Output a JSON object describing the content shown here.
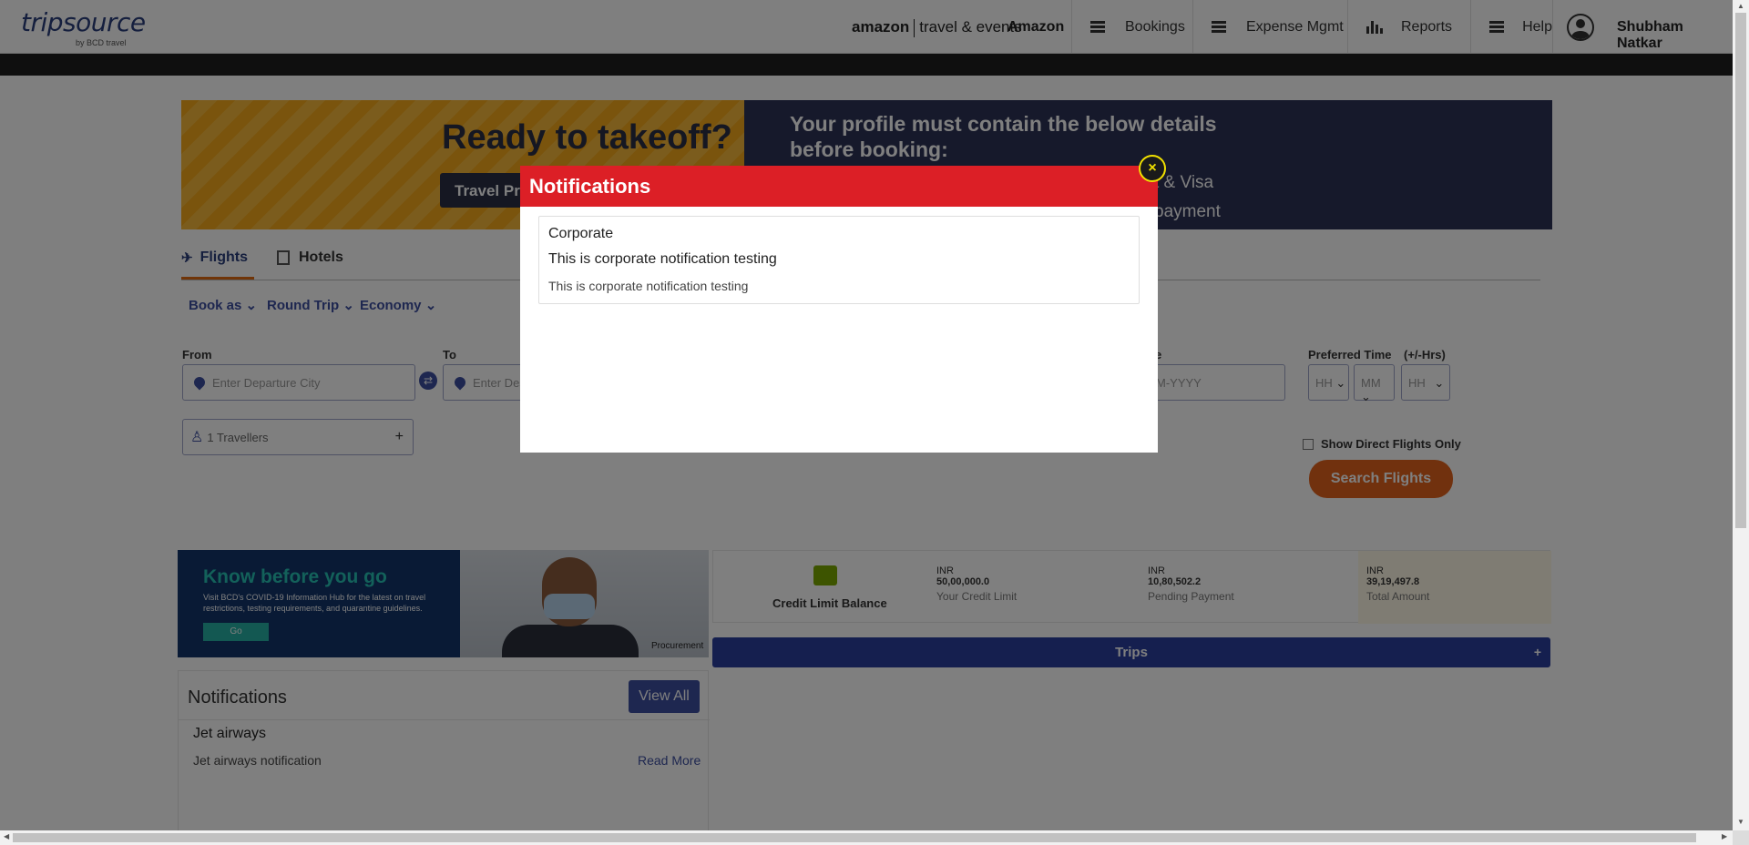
{
  "header": {
    "logo_text": "tripsource",
    "logo_sub": "by BCD travel",
    "partner_left": "amazon",
    "partner_right": "travel & events",
    "company": "Amazon",
    "nav": [
      {
        "label": "Bookings",
        "icon": "hamburger-icon"
      },
      {
        "label": "Expense Mgmt",
        "icon": "hamburger-icon"
      },
      {
        "label": "Reports",
        "icon": "bar-chart-icon"
      },
      {
        "label": "Help",
        "icon": "hamburger-icon"
      }
    ],
    "user_name": "Shubham Natkar"
  },
  "banner": {
    "title": "Ready to takeoff?",
    "button_label": "Travel Pr",
    "right_title": "Your profile must contain the below details before booking:",
    "right_line1": "t & Visa",
    "right_line2": "payment"
  },
  "tabs": [
    {
      "label": "Flights",
      "icon": "plane-icon"
    },
    {
      "label": "Hotels",
      "icon": "building-icon"
    }
  ],
  "options": {
    "book_as": "Book as",
    "trip_type": "Round Trip",
    "cabin": "Economy"
  },
  "form": {
    "from_label": "From",
    "from_placeholder": "Enter Departure City",
    "to_label": "To",
    "to_placeholder": "Enter Des",
    "date_label_partial": "e",
    "date_placeholder": "M-YYYY",
    "preferred_time_label": "Preferred Time",
    "plus_minus_label": "(+/-Hrs)",
    "hh": "HH",
    "mm": "MM",
    "hrs": "HH",
    "travellers": "1 Travellers",
    "direct_flights": "Show Direct Flights Only",
    "search_button": "Search Flights"
  },
  "covid": {
    "heading": "Know before you go",
    "text": "Visit BCD's COVID-19 Information Hub for the latest on travel restrictions, testing requirements, and quarantine guidelines.",
    "go": "Go",
    "procurement": "Procurement"
  },
  "credit": {
    "label": "Credit Limit Balance",
    "items": [
      {
        "currency": "INR",
        "amount": "50,00,000.0",
        "caption": "Your Credit Limit"
      },
      {
        "currency": "INR",
        "amount": "10,80,502.2",
        "caption": "Pending Payment"
      },
      {
        "currency": "INR",
        "amount": "39,19,497.8",
        "caption": "Total Amount"
      }
    ]
  },
  "trips": {
    "label": "Trips",
    "toggle": "+"
  },
  "notifications_panel": {
    "heading": "Notifications",
    "view_all": "View All",
    "item_title": "Jet airways",
    "item_desc": "Jet airways notification",
    "read_more": "Read More"
  },
  "modal": {
    "title": "Notifications",
    "close": "×",
    "category": "Corporate",
    "item_title": "This is corporate notification testing",
    "item_desc": "This is corporate notification testing"
  },
  "colors": {
    "brand_blue": "#3d4fa0",
    "modal_red": "#dc1f26",
    "accent_orange": "#e2631c"
  }
}
